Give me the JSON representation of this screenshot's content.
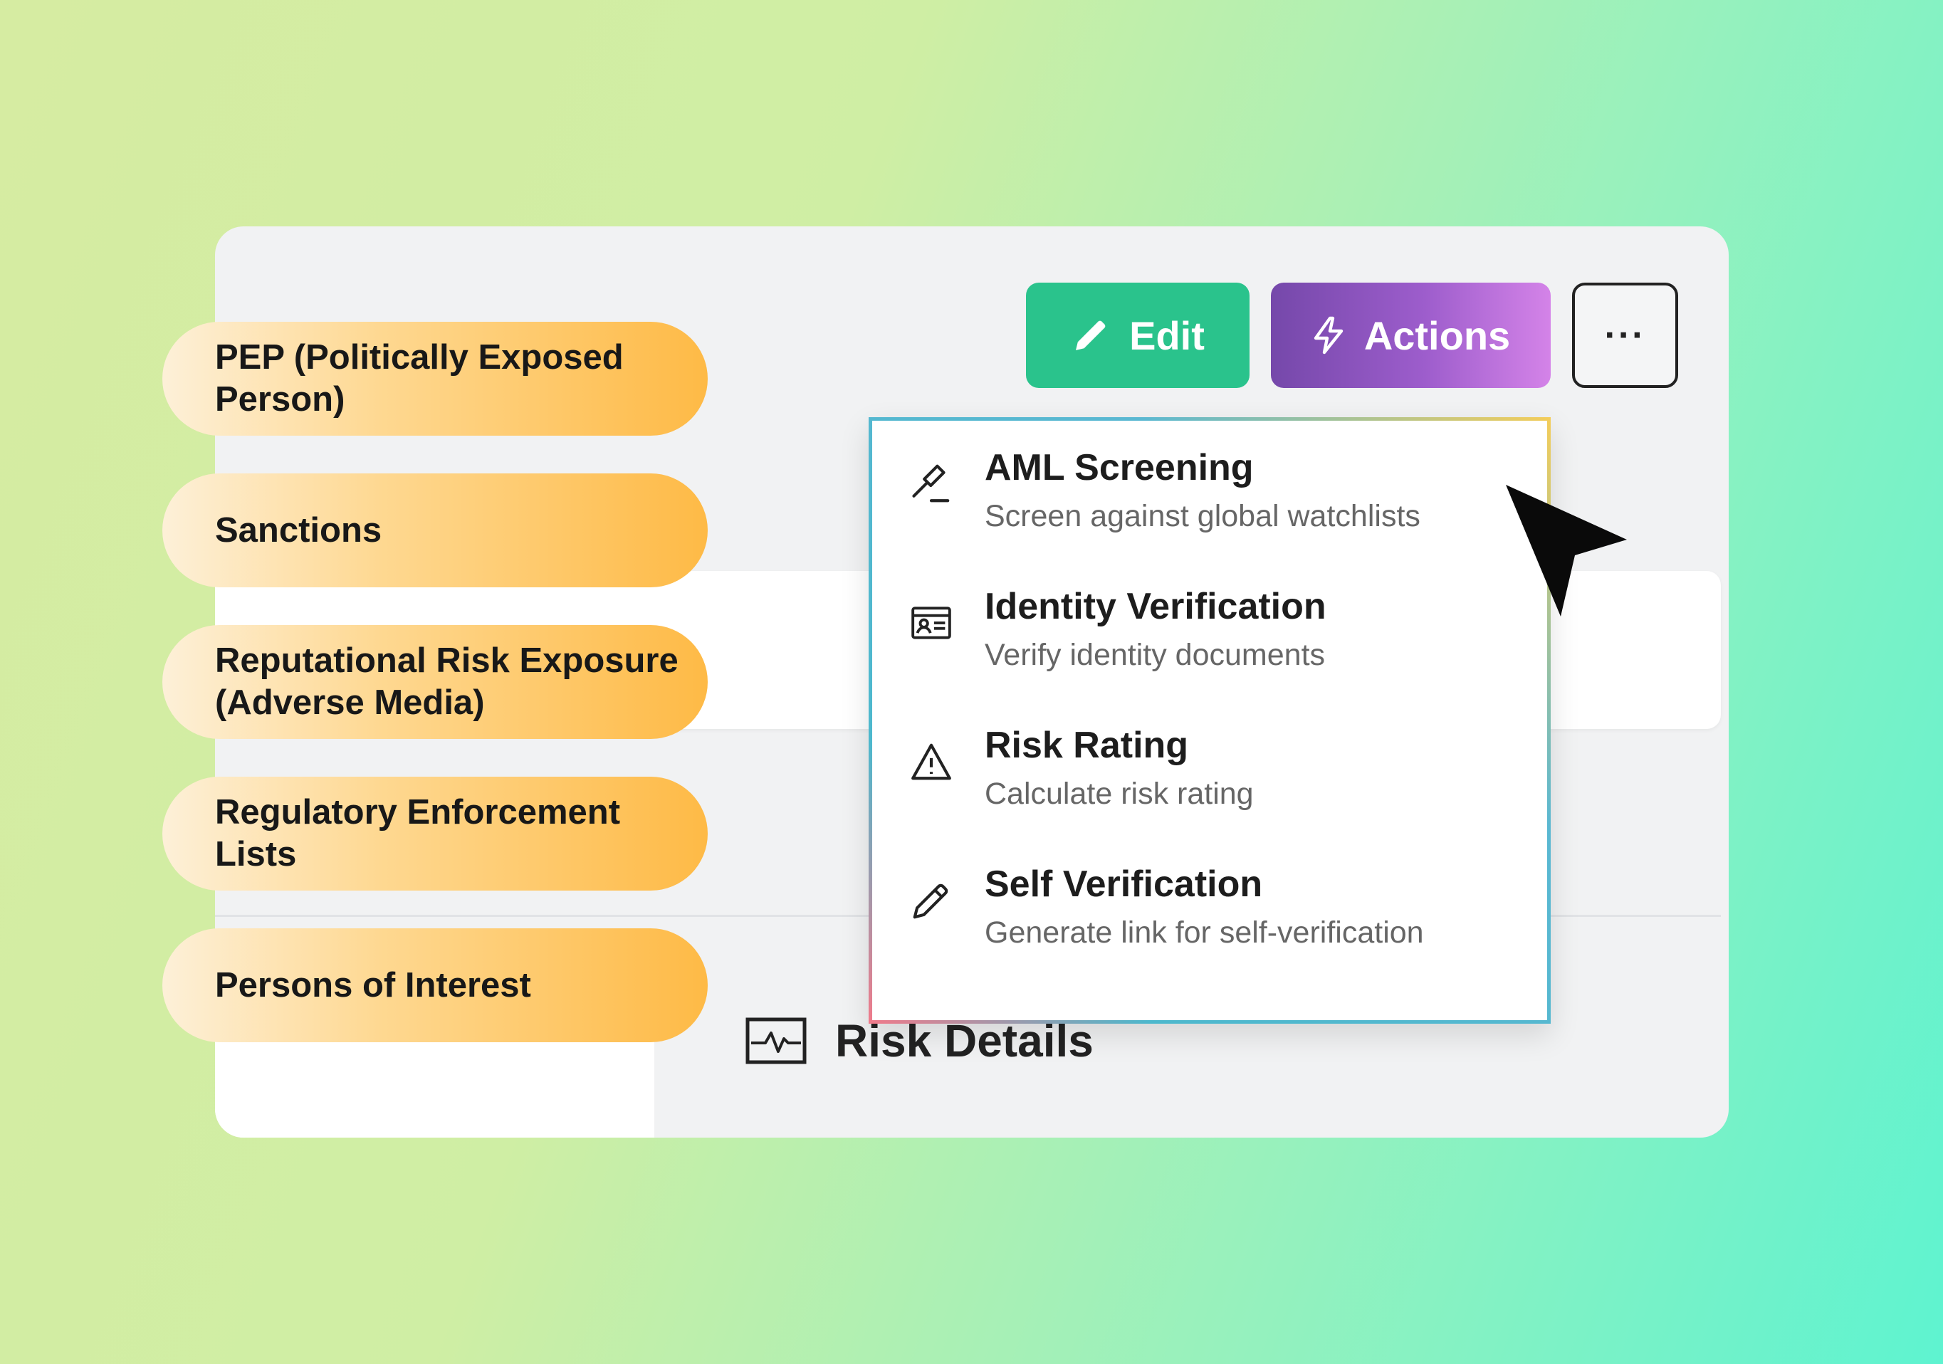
{
  "toolbar": {
    "edit_label": "Edit",
    "actions_label": "Actions",
    "more_label": "···"
  },
  "tags": [
    "PEP (Politically Exposed Person)",
    "Sanctions",
    "Reputational Risk Exposure (Adverse Media)",
    "Regulatory Enforcement Lists",
    "Persons of Interest"
  ],
  "actions_menu": {
    "items": [
      {
        "label": "AML Screening",
        "description": "Screen against global watchlists",
        "icon": "gavel-icon"
      },
      {
        "label": "Identity Verification",
        "description": "Verify identity documents",
        "icon": "id-card-icon"
      },
      {
        "label": "Risk Rating",
        "description": "Calculate risk rating",
        "icon": "warning-triangle-icon"
      },
      {
        "label": "Self Verification",
        "description": "Generate link for self-verification",
        "icon": "pencil-icon"
      }
    ]
  },
  "section": {
    "title": "Risk Details",
    "icon": "activity-monitor-icon"
  },
  "colors": {
    "edit_button": "#2ac38c",
    "actions_button": "#7548aa",
    "tag_pill": "#feba46"
  }
}
